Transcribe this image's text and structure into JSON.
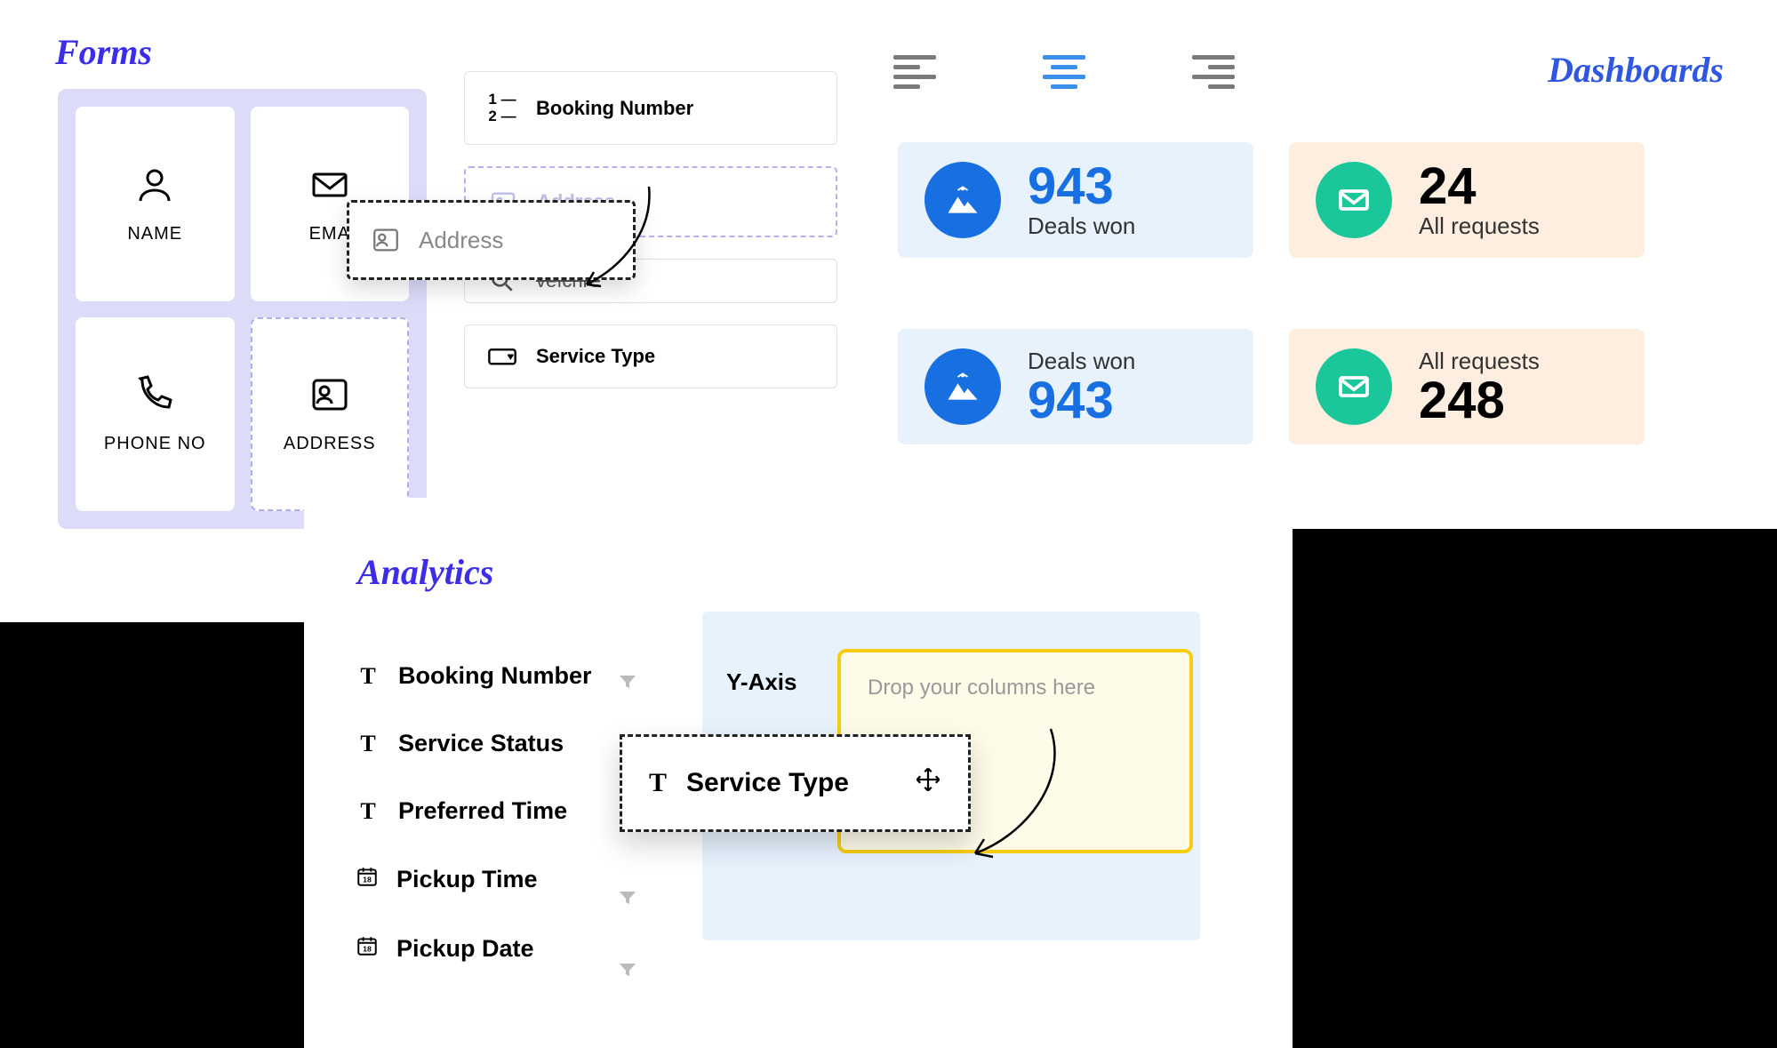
{
  "sections": {
    "forms_title": "Forms",
    "dashboards_title": "Dashboards",
    "analytics_title": "Analytics"
  },
  "forms": {
    "tiles": [
      {
        "label": "NAME"
      },
      {
        "label": "EMAIL",
        "truncated": "EMA"
      },
      {
        "label": "PHONE NO"
      },
      {
        "label": "ADDRESS"
      }
    ],
    "rows": {
      "booking_number": "Booking Number",
      "address_placeholder": "Address",
      "vehicle_truncated": "veıcnre",
      "service_type": "Service Type"
    },
    "drag_chip": "Address"
  },
  "dashboards": {
    "cards": [
      {
        "value": "943",
        "label": "Deals won"
      },
      {
        "value": "24",
        "label": "All requests"
      },
      {
        "value": "943",
        "label": "Deals won"
      },
      {
        "value": "248",
        "label": "All requests"
      }
    ]
  },
  "analytics": {
    "columns": [
      {
        "type": "text",
        "label": "Booking Number"
      },
      {
        "type": "text",
        "label": "Service Status"
      },
      {
        "type": "text",
        "label": "Preferred Time"
      },
      {
        "type": "date",
        "label": "Pickup Time"
      },
      {
        "type": "date",
        "label": "Pickup Date"
      }
    ],
    "yaxis_label": "Y-Axis",
    "drop_placeholder": "Drop your columns here",
    "drag_chip": "Service Type"
  }
}
